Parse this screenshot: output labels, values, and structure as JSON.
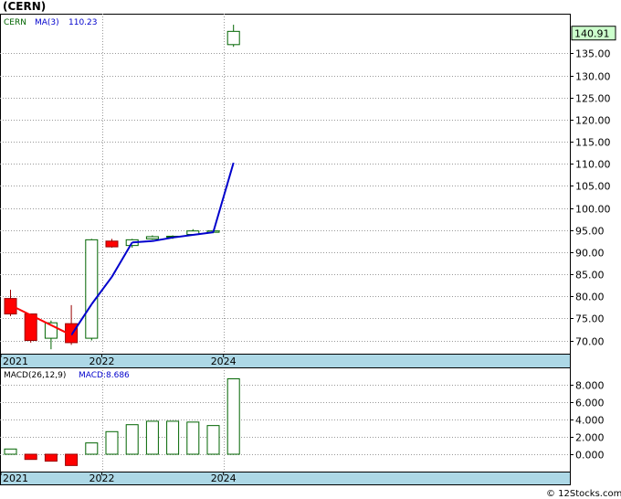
{
  "ticker_title": "(CERN)",
  "watermark": "© 12Stocks.com",
  "colors": {
    "up_fill": "#ffffff",
    "up_stroke": "#006400",
    "down_fill": "#ff0000",
    "down_stroke": "#990000",
    "ma_line": "#0000cc",
    "ma_down": "#ff0000",
    "hist_stroke": "#006400",
    "hist_down": "#ff0000",
    "axis_band": "#add8e6",
    "grid": "#999999",
    "price_box_fill": "#ccffcc"
  },
  "chart_data": [
    {
      "type": "candlestick",
      "legend": {
        "symbol": "CERN",
        "ma_label": "MA(3)",
        "ma_value": "110.23"
      },
      "last_price_label": "140.91",
      "ylim": [
        67,
        144
      ],
      "yticks": [
        "70.00",
        "75.00",
        "80.00",
        "85.00",
        "90.00",
        "95.00",
        "100.00",
        "105.00",
        "110.00",
        "115.00",
        "120.00",
        "125.00",
        "130.00",
        "135.00"
      ],
      "ytick_values": [
        70,
        75,
        80,
        85,
        90,
        95,
        100,
        105,
        110,
        115,
        120,
        125,
        130,
        135
      ],
      "xlabels": [
        "2021",
        "2022",
        "2024"
      ],
      "xlabel_index": [
        0,
        5,
        11
      ],
      "candles": [
        {
          "o": 79.5,
          "h": 81.5,
          "l": 75.5,
          "c": 76.0
        },
        {
          "o": 76.0,
          "h": 76.0,
          "l": 69.5,
          "c": 70.0
        },
        {
          "o": 70.5,
          "h": 74.5,
          "l": 68.0,
          "c": 74.0
        },
        {
          "o": 73.8,
          "h": 78.0,
          "l": 69.0,
          "c": 69.5
        },
        {
          "o": 70.5,
          "h": 93.0,
          "l": 70.0,
          "c": 92.8
        },
        {
          "o": 92.5,
          "h": 93.0,
          "l": 91.0,
          "c": 91.2
        },
        {
          "o": 91.5,
          "h": 93.0,
          "l": 91.0,
          "c": 92.8
        },
        {
          "o": 93.0,
          "h": 93.8,
          "l": 92.8,
          "c": 93.5
        },
        {
          "o": 93.5,
          "h": 93.8,
          "l": 93.0,
          "c": 93.6
        },
        {
          "o": 94.0,
          "h": 95.2,
          "l": 93.8,
          "c": 94.8
        },
        {
          "o": 94.5,
          "h": 95.0,
          "l": 94.3,
          "c": 94.8
        },
        {
          "o": 137.0,
          "h": 141.5,
          "l": 136.5,
          "c": 140.0
        }
      ],
      "ma": [
        null,
        null,
        null,
        71.2,
        78.2,
        84.4,
        92.2,
        92.5,
        93.3,
        93.9,
        94.5,
        110.23
      ]
    },
    {
      "type": "bar",
      "legend": {
        "label": "MACD(26,12,9)",
        "value_label": "MACD:8.686"
      },
      "ylim": [
        -2.0,
        10.0
      ],
      "yticks": [
        "0.000",
        "2.000",
        "4.000",
        "6.000",
        "8.000"
      ],
      "ytick_values": [
        0,
        2,
        4,
        6,
        8
      ],
      "xlabels": [
        "2021",
        "2022",
        "2024"
      ],
      "xlabel_index": [
        0,
        5,
        11
      ],
      "values": [
        0.6,
        -0.6,
        -0.8,
        -1.3,
        1.3,
        2.6,
        3.4,
        3.8,
        3.8,
        3.7,
        3.3,
        8.686
      ]
    }
  ]
}
